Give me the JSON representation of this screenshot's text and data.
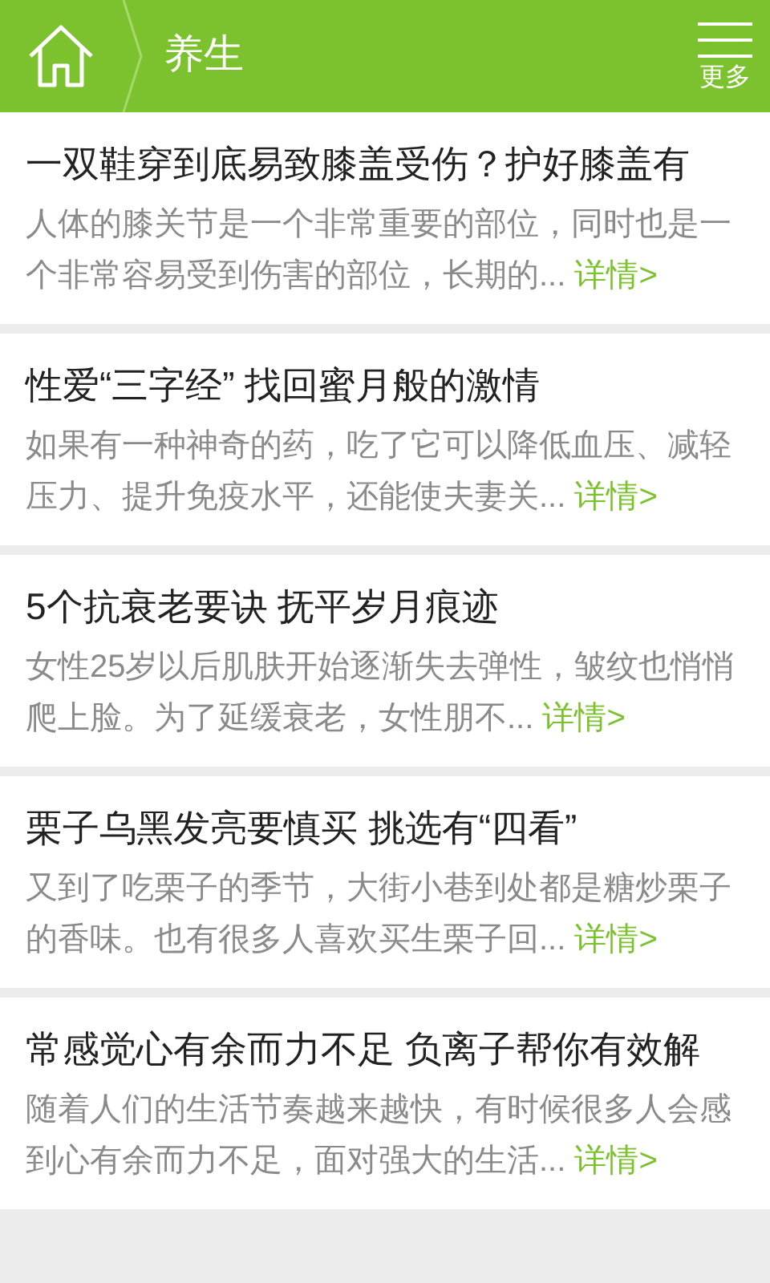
{
  "header": {
    "title": "养生",
    "more": "更多"
  },
  "articles": [
    {
      "title": "一双鞋穿到底易致膝盖受伤？护好膝盖有",
      "summary": "人体的膝关节是一个非常重要的部位，同时也是一个非常容易受到伤害的部位，长期的...",
      "link": "详情>"
    },
    {
      "title": "性爱“三字经” 找回蜜月般的激情",
      "summary": "如果有一种神奇的药，吃了它可以降低血压、减轻压力、提升免疫水平，还能使夫妻关...",
      "link": "详情>"
    },
    {
      "title": "5个抗衰老要诀 抚平岁月痕迹",
      "summary": "女性25岁以后肌肤开始逐渐失去弹性，皱纹也悄悄爬上脸。为了延缓衰老，女性朋不...",
      "link": "详情>"
    },
    {
      "title": "栗子乌黑发亮要慎买 挑选有“四看”",
      "summary": "又到了吃栗子的季节，大街小巷到处都是糖炒栗子的香味。也有很多人喜欢买生栗子回...",
      "link": "详情>"
    },
    {
      "title": "常感觉心有余而力不足 负离子帮你有效解",
      "summary": "随着人们的生活节奏越来越快，有时候很多人会感到心有余而力不足，面对强大的生活...",
      "link": "详情>"
    }
  ]
}
